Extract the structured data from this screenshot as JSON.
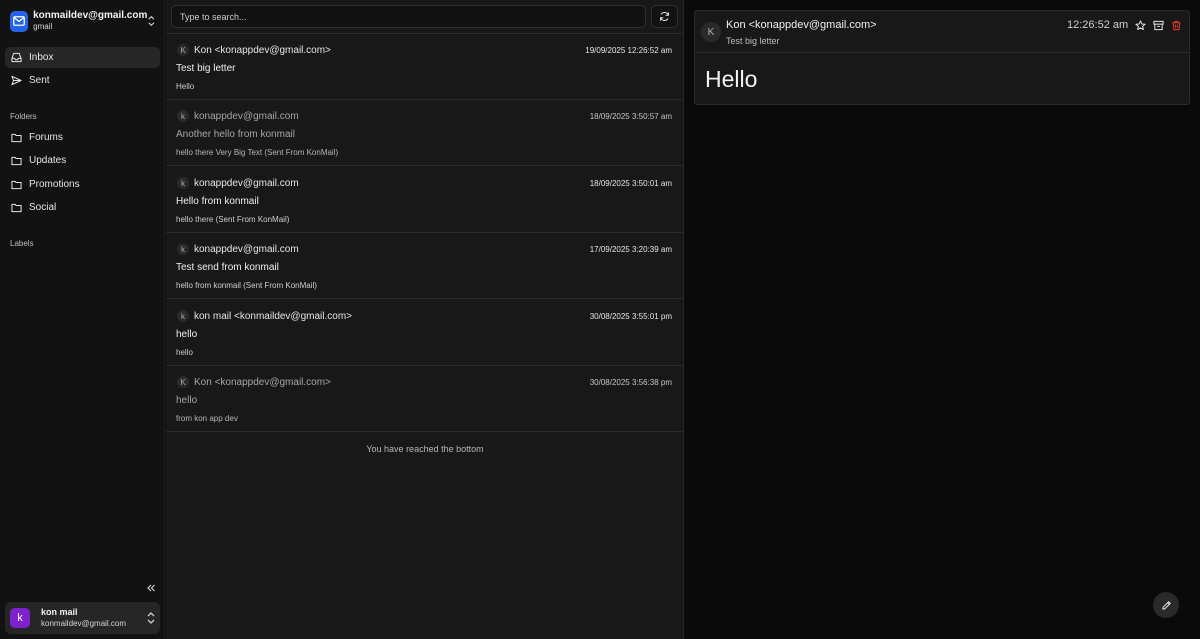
{
  "account": {
    "email": "konmaildev@gmail.com",
    "provider": "gmail",
    "icon": "mail-icon",
    "accent": "#2563eb"
  },
  "nav": [
    {
      "label": "Inbox",
      "icon": "inbox-icon",
      "active": true
    },
    {
      "label": "Sent",
      "icon": "send-icon",
      "active": false
    }
  ],
  "folders_heading": "Folders",
  "folders": [
    {
      "label": "Forums",
      "icon": "folder-icon"
    },
    {
      "label": "Updates",
      "icon": "folder-icon"
    },
    {
      "label": "Promotions",
      "icon": "folder-icon"
    },
    {
      "label": "Social",
      "icon": "folder-icon"
    }
  ],
  "labels_heading": "Labels",
  "user": {
    "initial": "k",
    "name": "kon mail",
    "email": "konmaildev@gmail.com",
    "avatar_color": "#7e22ce"
  },
  "search": {
    "placeholder": "Type to search..."
  },
  "mails": [
    {
      "avatar": "K",
      "from": "Kon <konappdev@gmail.com>",
      "date": "19/09/2025 12:26:52 am",
      "subject": "Test big letter",
      "preview": "Hello",
      "read": false
    },
    {
      "avatar": "k",
      "from": "konappdev@gmail.com",
      "date": "18/09/2025 3:50:57 am",
      "subject": "Another hello from konmail",
      "preview": "hello there Very Big Text (Sent From KonMail)",
      "read": true
    },
    {
      "avatar": "k",
      "from": "konappdev@gmail.com",
      "date": "18/09/2025 3:50:01 am",
      "subject": "Hello from konmail",
      "preview": "hello there (Sent From KonMail)",
      "read": false
    },
    {
      "avatar": "k",
      "from": "konappdev@gmail.com",
      "date": "17/09/2025 3:20:39 am",
      "subject": "Test send from konmail",
      "preview": "hello from konmail (Sent From KonMail)",
      "read": false
    },
    {
      "avatar": "k",
      "from": "kon mail <konmaildev@gmail.com>",
      "date": "30/08/2025 3:55:01 pm",
      "subject": "hello",
      "preview": "hello",
      "read": false
    },
    {
      "avatar": "K",
      "from": "Kon <konappdev@gmail.com>",
      "date": "30/08/2025 3:56:38 pm",
      "subject": "hello",
      "preview": "from kon app dev",
      "read": true
    }
  ],
  "bottom_note": "You have reached the bottom",
  "message": {
    "avatar": "K",
    "from": "Kon <konappdev@gmail.com>",
    "subject": "Test big letter",
    "time": "12:26:52 am",
    "body": "Hello",
    "delete_color": "#e53935"
  }
}
